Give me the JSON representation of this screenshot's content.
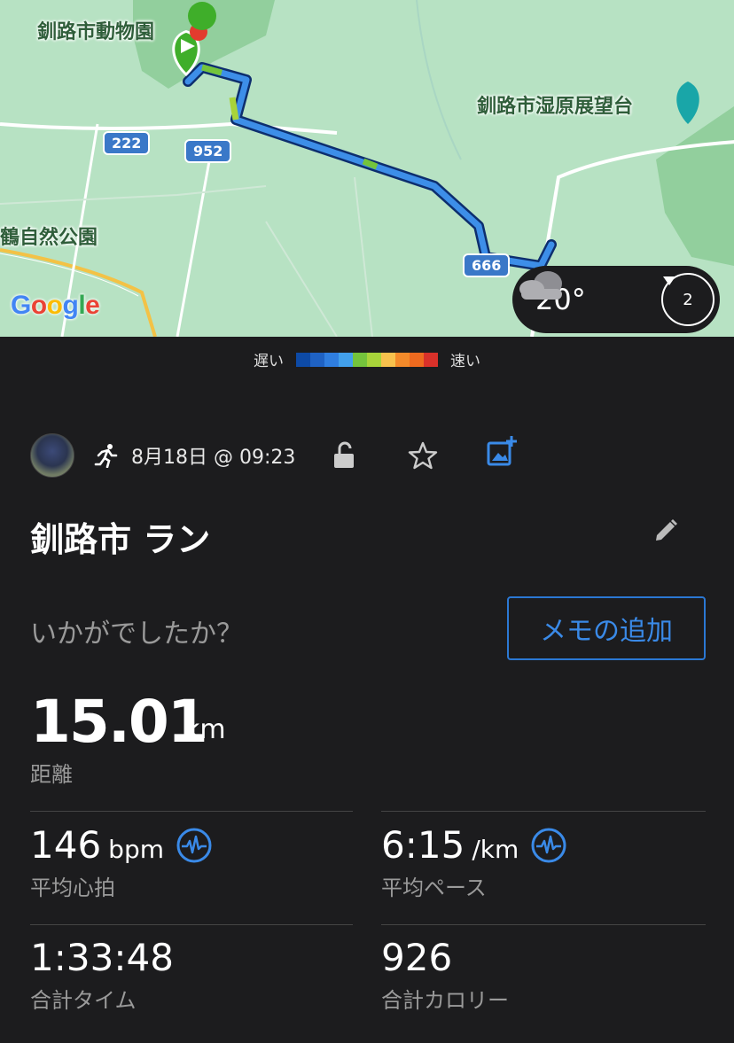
{
  "map": {
    "labels": {
      "zoo": "釧路市動物園",
      "observatory": "釧路市湿原展望台",
      "park": "鶴自然公園"
    },
    "roads": [
      "222",
      "952",
      "666"
    ],
    "attribution": "Google",
    "weather": {
      "temperature": "20°",
      "condition_icon": "cloud-icon",
      "wind_index": "2"
    }
  },
  "speed_legend": {
    "slow_label": "遅い",
    "fast_label": "速い",
    "colors": [
      "#0d4aa6",
      "#1f62c4",
      "#2f7ee0",
      "#42a0ec",
      "#74c43c",
      "#a8d43a",
      "#f7c14d",
      "#f38a2a",
      "#ee6a1f",
      "#d9312a"
    ]
  },
  "activity": {
    "type_icon": "running-icon",
    "date": "8月18日 @ 09:23",
    "title": "釧路市 ラン",
    "prompt": "いかがでしたか？",
    "memo_button": "メモの追加",
    "accent_color": "#3a8ae8"
  },
  "stats": {
    "distance": {
      "value": "15.01",
      "unit": "km",
      "label": "距離"
    },
    "avg_heart_rate": {
      "value": "146",
      "unit": "bpm",
      "label": "平均心拍"
    },
    "avg_pace": {
      "value": "6:15",
      "unit": "/km",
      "label": "平均ペース"
    },
    "total_time": {
      "value": "1:33:48",
      "label": "合計タイム"
    },
    "total_calories": {
      "value": "926",
      "label": "合計カロリー"
    }
  }
}
